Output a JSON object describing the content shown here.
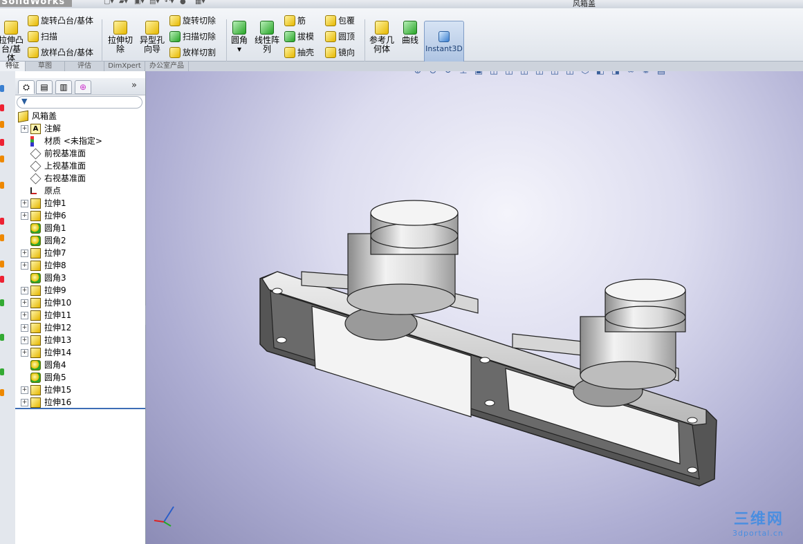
{
  "app": {
    "logo": "SolidWorks",
    "window_title": "风箱盖"
  },
  "ribbon": {
    "extrude_boss_line1": "拉伸凸",
    "extrude_boss_line2": "台/基体",
    "revolve_boss": "旋转凸台/基体",
    "sweep": "扫描",
    "loft_boss": "放样凸台/基体",
    "extrude_cut_line1": "拉伸切",
    "extrude_cut_line2": "除",
    "hole_wizard_line1": "异型孔",
    "hole_wizard_line2": "向导",
    "revolve_cut": "旋转切除",
    "sweep_cut": "扫描切除",
    "loft_cut": "放样切割",
    "fillet": "圆角",
    "linear_pattern_line1": "线性阵",
    "linear_pattern_line2": "列",
    "rib": "筋",
    "draft": "拔模",
    "shell": "抽壳",
    "wrap": "包覆",
    "dome": "圆顶",
    "mirror": "镜向",
    "ref_geometry_line1": "参考几",
    "ref_geometry_line2": "何体",
    "curves": "曲线",
    "instant3d": "Instant3D"
  },
  "cm_tabs": [
    "特征",
    "草图",
    "评估",
    "DimXpert",
    "办公室产品"
  ],
  "tree": {
    "root": "风箱盖",
    "items": [
      {
        "label": "注解",
        "icon": "annotation-icon",
        "expandable": true
      },
      {
        "label": "材质 <未指定>",
        "icon": "material-icon",
        "expandable": false
      },
      {
        "label": "前视基准面",
        "icon": "plane-icon",
        "expandable": false
      },
      {
        "label": "上视基准面",
        "icon": "plane-icon",
        "expandable": false
      },
      {
        "label": "右视基准面",
        "icon": "plane-icon",
        "expandable": false
      },
      {
        "label": "原点",
        "icon": "origin-icon",
        "expandable": false
      },
      {
        "label": "拉伸1",
        "icon": "extrude-icon",
        "expandable": true
      },
      {
        "label": "拉伸6",
        "icon": "extrude-icon",
        "expandable": true
      },
      {
        "label": "圆角1",
        "icon": "fillet-icon",
        "expandable": false
      },
      {
        "label": "圆角2",
        "icon": "fillet-icon",
        "expandable": false
      },
      {
        "label": "拉伸7",
        "icon": "extrude-icon",
        "expandable": true
      },
      {
        "label": "拉伸8",
        "icon": "extrude-icon",
        "expandable": true
      },
      {
        "label": "圆角3",
        "icon": "fillet-icon",
        "expandable": false
      },
      {
        "label": "拉伸9",
        "icon": "extrude-icon",
        "expandable": true
      },
      {
        "label": "拉伸10",
        "icon": "extrude-icon",
        "expandable": true
      },
      {
        "label": "拉伸11",
        "icon": "extrude-icon",
        "expandable": true
      },
      {
        "label": "拉伸12",
        "icon": "extrude-icon",
        "expandable": true
      },
      {
        "label": "拉伸13",
        "icon": "extrude-icon",
        "expandable": true
      },
      {
        "label": "拉伸14",
        "icon": "extrude-icon",
        "expandable": true
      },
      {
        "label": "圆角4",
        "icon": "fillet-icon",
        "expandable": false
      },
      {
        "label": "圆角5",
        "icon": "fillet-icon",
        "expandable": false
      },
      {
        "label": "拉伸15",
        "icon": "extrude-icon",
        "expandable": true
      },
      {
        "label": "拉伸16",
        "icon": "extrude-icon",
        "expandable": true
      }
    ]
  },
  "panel": {
    "more": "»"
  },
  "watermark": {
    "line1": "三维网",
    "line2": "3dportal.cn"
  }
}
